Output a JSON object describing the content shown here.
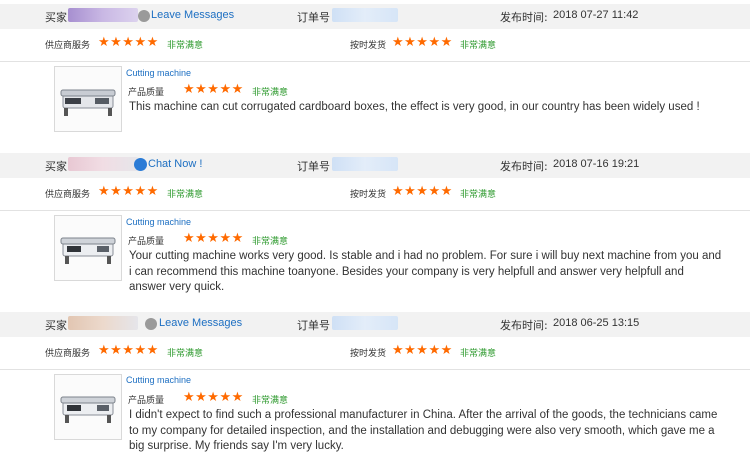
{
  "labels": {
    "buyer": "买家",
    "order_no": "订单号",
    "post_time": "发布时间:",
    "supplier_service": "供应商服务",
    "on_time_shipping": "按时发货",
    "product_quality": "产品质量",
    "very_satisfied": "非常满意"
  },
  "colors": {
    "stars": "#ff6a00",
    "link": "#1d6fc2",
    "satisfied": "#2e9a2e",
    "header_bg": "#f2f2f2"
  },
  "reviews": [
    {
      "contact_action": "Leave Messages",
      "contact_icon": "user-icon",
      "post_time": "2018 07-27 11:42",
      "supplier_rating": 5,
      "shipping_rating": 5,
      "product_name": "Cutting machine",
      "quality_rating": 5,
      "comment": "This machine can cut corrugated cardboard boxes, the effect is very good, in our country has been widely used !"
    },
    {
      "contact_action": "Chat Now !",
      "contact_icon": "chat-icon",
      "post_time": "2018 07-16 19:21",
      "supplier_rating": 5,
      "shipping_rating": 5,
      "product_name": "Cutting machine",
      "quality_rating": 5,
      "comment": "Your cutting machine works very good. Is stable and i had no problem. For sure i will buy next machine from you and i can recommend this machine toanyone.  Besides your company is very helpfull and answer very helpfull and answer very quick."
    },
    {
      "contact_action": "Leave Messages",
      "contact_icon": "user-icon",
      "post_time": "2018 06-25 13:15",
      "supplier_rating": 5,
      "shipping_rating": 5,
      "product_name": "Cutting machine",
      "quality_rating": 5,
      "comment": "I didn't expect to find such a professional manufacturer in China. After the arrival of the goods, the technicians came to my company for detailed inspection, and the installation and debugging were also very smooth, which gave me a big surprise. My friends say I'm very lucky."
    }
  ]
}
